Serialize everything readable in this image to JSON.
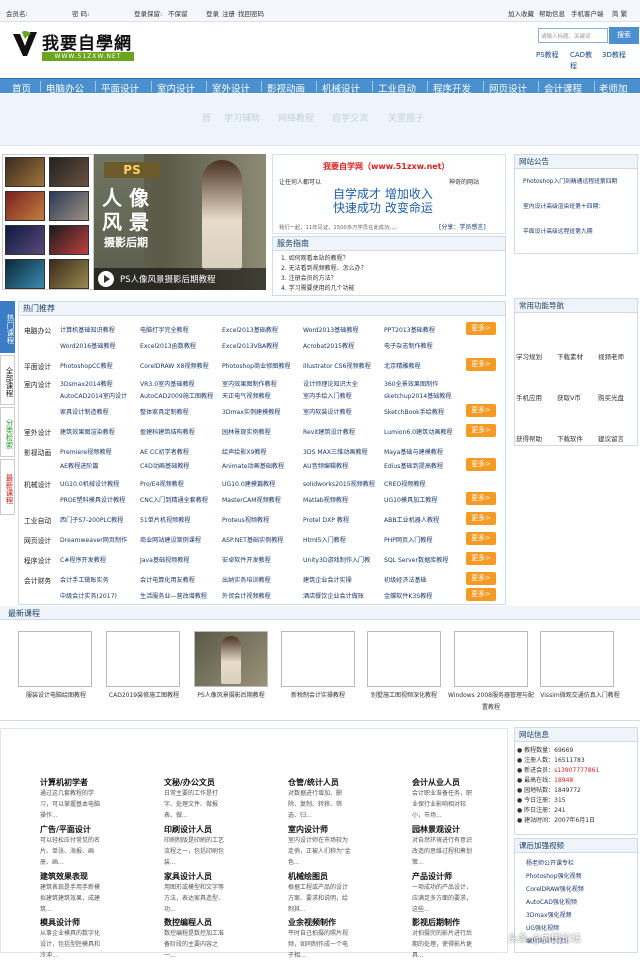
{
  "topbar": {
    "member_label": "会员名:",
    "password_label": "密 码:",
    "keep_label": "登录保留:",
    "keep_value": "不保留",
    "login": "登录",
    "register": "注册",
    "forgot": "找回密码",
    "fav": "加入收藏",
    "help": "帮助信息",
    "mobile": "手机客户端",
    "simple": "简 繁"
  },
  "logo": {
    "title": "我要自學網",
    "url": "WWW.51ZXW.NET"
  },
  "search": {
    "placeholder": "请输入标题、关键词",
    "button": "搜索"
  },
  "top_links": [
    "PS教程",
    "CAD教程",
    "3D教程"
  ],
  "nav": [
    "首页",
    "电脑办公",
    "平面设计",
    "室内设计",
    "室外设计",
    "影视动画",
    "机械设计",
    "工业自动",
    "程序开发",
    "网页设计",
    "会计课程",
    "老师加"
  ],
  "subnav": [
    "首",
    "学习辅助",
    "网络教程",
    "自学交流",
    "关里圈子"
  ],
  "banner": {
    "ps_badge": "PS",
    "big1": "人 像",
    "big2": "风 景",
    "big3": "摄影后期",
    "caption": "PS人像风景摄影后期教程"
  },
  "promo": {
    "title": "我要自学网（www.51zxw.net）",
    "line1": "让任何人都可以",
    "line1b": "神奇的网站",
    "slogan1": "自学成才  增加收入",
    "slogan2": "快速成功  改变命运",
    "desc": "我们一起，11年见证，1500多万学员在此成功。。。",
    "share": "[分享：学员感言]"
  },
  "guide": {
    "title": "服务指南",
    "items": [
      "1. 如何观看本站的教程？",
      "2. 无法看到视频教程、怎么办？",
      "3. 注册会员的方法？",
      "4. 学习需要使用的几个功能"
    ]
  },
  "notice": {
    "title": "网站公告",
    "items": [
      "Photoshop入门到精通远程班第四期",
      "室内设计高级渲染班第十四期：",
      "平面设计高级远程班第九期"
    ]
  },
  "side_tabs": [
    {
      "label": "热门课程",
      "color": "#ffffff",
      "bg": "#3a7cc6"
    },
    {
      "label": "全部课程",
      "color": "#222222",
      "bg": "#ffffff"
    },
    {
      "label": "分类检索",
      "color": "#2aa02a",
      "bg": "#ffffff"
    },
    {
      "label": "最新课程",
      "color": "#d02020",
      "bg": "#ffffff"
    }
  ],
  "hot": {
    "title": "热门推荐",
    "more": "更多>",
    "rows": [
      {
        "cat": "电脑办公",
        "items": [
          "计算机基础知识教程",
          "电脑打字完全教程",
          "Excel2013基础教程",
          "Word2013基础教程",
          "PPT2013基础教程"
        ]
      },
      {
        "cat": "",
        "items": [
          "Word2016基础教程",
          "Excel2013函数教程",
          "Excel2013VBA教程",
          "Acrobat2015教程",
          "电子杂志制作教程"
        ]
      },
      {
        "cat": "平面设计",
        "items": [
          "PhotoshopCC教程",
          "CorelDRAW X8视频教程",
          "Photoshop商业修图教程",
          "Illustrator CS6视频教程",
          "北京精雕教程"
        ]
      },
      {
        "cat": "室内设计",
        "items": [
          "3Dsmax2014教程",
          "VR3.0室内基础教程",
          "室内效果图制作教程",
          "设计师理论知识大全",
          "360全景效果图制作"
        ]
      },
      {
        "cat": "",
        "items": [
          "AutoCAD2014室内设计",
          "AutoCAD2009施工图教程",
          "天正电气视频教程",
          "室内手绘入门教程",
          "sketchup2014基础教程"
        ]
      },
      {
        "cat": "",
        "items": [
          "家具设计制造教程",
          "整体家具定制教程",
          "3Dmax实例建模教程",
          "室内软装设计教程",
          "SketchBook手绘教程"
        ]
      },
      {
        "cat": "室外设计",
        "items": [
          "建筑效果图渲染教程",
          "盈建科建筑结构教程",
          "园林景观实例教程",
          "Revit建筑设计教程",
          "Lumion6.0建筑动画教程"
        ]
      },
      {
        "cat": "影视动画",
        "items": [
          "Premiere视频教程",
          "AE CC初学者教程",
          "绘声绘影X9教程",
          "3DS MAX三维动画教程",
          "Maya基础与建模教程"
        ]
      },
      {
        "cat": "",
        "items": [
          "AE教程进阶篇",
          "C4D动画基础教程",
          "Animate动画基础教程",
          "AU音频编辑教程",
          "Edius基础到提高教程"
        ]
      },
      {
        "cat": "机械设计",
        "items": [
          "UG10.0机械设计教程",
          "Pro/E4视频教程",
          "UG10.0建模篇教程",
          "solidworks2015视频教程",
          "CREO视频教程"
        ]
      },
      {
        "cat": "",
        "items": [
          "PROE塑料模具设计教程",
          "CNC入门到精通全套教程",
          "MasterCAM视频教程",
          "Matlab视频教程",
          "UG10模具加工教程"
        ]
      },
      {
        "cat": "工业自动",
        "items": [
          "西门子S7-200PLC教程",
          "51单片机视频教程",
          "Proteus视频教程",
          "Protel DXP 教程",
          "ABB工业机器人教程"
        ]
      },
      {
        "cat": "网页设计",
        "items": [
          "Dreamweaver网页制作",
          "商业网站建设案例课程",
          "ASP.NET基础实例教程",
          "Html5入门教程",
          "PHP网页入门教程"
        ]
      },
      {
        "cat": "程序设计",
        "items": [
          "C#程序开发教程",
          "Java基础视频教程",
          "安卓软件开发教程",
          "Unity3D游戏制作入门教",
          "SQL Server数据库教程"
        ]
      },
      {
        "cat": "会计财务",
        "items": [
          "会计手工做账实务",
          "会计电算化用友教程",
          "出纳实务培训教程",
          "建筑企业会计实操",
          "初级经济法基础"
        ]
      },
      {
        "cat": "",
        "items": [
          "中级会计实务(2017)",
          "生活服务业—营改增教程",
          "外贸会计视频教程",
          "酒店餐饮企业会计做账",
          "金蝶软件K3S教程"
        ]
      }
    ]
  },
  "functions": {
    "title": "常用功能导航",
    "items": [
      "学习规划",
      "下载素材",
      "视频老师",
      "手机应用",
      "获取V币",
      "购买光盘",
      "获得帮助",
      "下载软件",
      "建议留言"
    ]
  },
  "latest": {
    "title": "最新课程",
    "items": [
      "服装设计电脑绘图教程",
      "CAD2019装修施工图教程",
      "PS人像风景摄影后期教程",
      "新税制会计实操教程",
      "别墅施工图视频深化教程",
      "Windows 2008服务器管理与配置教程",
      "Vissim微观交通仿真入门教程"
    ]
  },
  "careers": [
    {
      "title": "计算机初学者",
      "desc": "通过这几套教程的学习，可以掌握基本电脑操作..."
    },
    {
      "title": "文秘/办公文员",
      "desc": "日常主要的工作是打字、处理文件、做报表、做..."
    },
    {
      "title": "仓管/统计人员",
      "desc": "对数据进行增加、删除、复制、转移、筛选、归..."
    },
    {
      "title": "会计从业人员",
      "desc": "会计职业准备任务，职业保行业影响相对较小，市场..."
    },
    {
      "title": "广告/平面设计",
      "desc": "可以轻松应付常见的名片、单张、海报、画册、画..."
    },
    {
      "title": "印刷设计人员",
      "desc": "印刷制版是印刷的工艺流程之一，包括印刷包装..."
    },
    {
      "title": "室内设计师",
      "desc": "室内设计师在市场较为走俏，正被人们称为\"金色..."
    },
    {
      "title": "园林景观设计",
      "desc": "对自然环境进行有意识改造的思维过程和筹划策..."
    },
    {
      "title": "建筑效果表现",
      "desc": "建筑表现是手用手新模拟建筑建筑效果，成建筑..."
    },
    {
      "title": "家具设计人员",
      "desc": "用图形或模型和文字等方法，表达家具造型、功..."
    },
    {
      "title": "机械绘图员",
      "desc": "根据工程或产品的设计方案、要求和说明，绘制其..."
    },
    {
      "title": "产品设计师",
      "desc": "一项成功的产品设计，应满足多方面的要求，这些..."
    },
    {
      "title": "模具设计师",
      "desc": "从事企业模具的数字化设计，包括型腔模具和冷冲..."
    },
    {
      "title": "数控编程人员",
      "desc": "数控编程是数控加工准备阶段的主要内容之一..."
    },
    {
      "title": "业余视频制作",
      "desc": "平时自己拍摄的照片视频，如同制作成一个电子相..."
    },
    {
      "title": "影视后期制作",
      "desc": "对拍摄完的影片进行后期的处理，使得影片更具..."
    }
  ],
  "site_info": {
    "title": "网站信息",
    "stats": [
      {
        "label": "● 教程数量：",
        "value": "69669",
        "red": false
      },
      {
        "label": "● 注册人数：",
        "value": "16511783",
        "red": false
      },
      {
        "label": "● 新进会员：",
        "value": "s13907777861",
        "red": true
      },
      {
        "label": "● 最高在线：",
        "value": "18948",
        "red": true
      },
      {
        "label": "● 园地帖数：",
        "value": "1849772",
        "red": false
      },
      {
        "label": "● 今日注册：",
        "value": "315",
        "red": false
      },
      {
        "label": "● 昨日注册：",
        "value": "241",
        "red": false
      },
      {
        "label": "● 建站时间：",
        "value": "2007年6月1日",
        "red": false
      }
    ]
  },
  "boost": {
    "title": "课后加强视频",
    "items": [
      "杨老师公开课专栏",
      "Photoshop强化视频",
      "CorelDRAW强化视频",
      "AutoCAD强化视频",
      "3Dmax强化视频",
      "UG强化视频",
      "编程网页等视频"
    ]
  },
  "watermark": "头条 @中国论坛"
}
